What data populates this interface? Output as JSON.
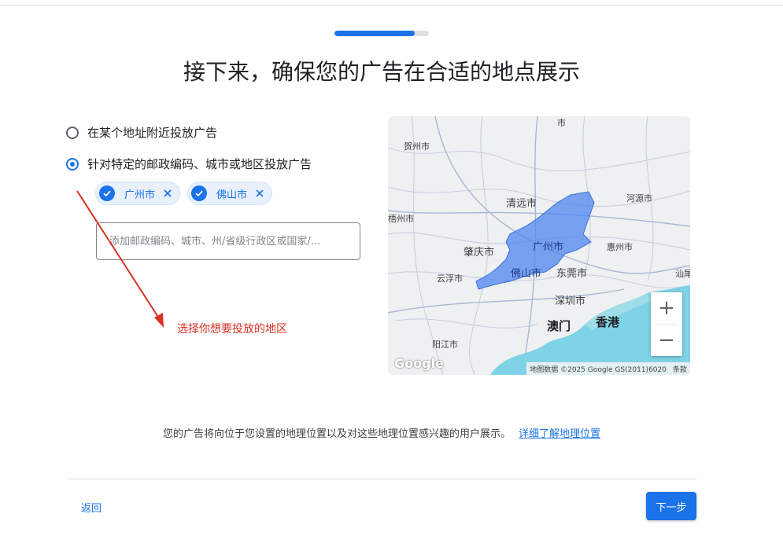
{
  "progress": {
    "percent": 85
  },
  "heading": {
    "title": "接下来，确保您的广告在合适的地点展示"
  },
  "targeting": {
    "options": [
      {
        "label": "在某个地址附近投放广告",
        "selected": false
      },
      {
        "label": "针对特定的邮政编码、城市或地区投放广告",
        "selected": true
      }
    ],
    "chips": [
      {
        "label": "广州市"
      },
      {
        "label": "佛山市"
      }
    ],
    "search_placeholder": "添加邮政编码、城市、州/省级行政区或国家/..."
  },
  "annotation": {
    "text": "选择你想要投放的地区",
    "color": "#d93025"
  },
  "map": {
    "cities": {
      "hezhou": "贺州市",
      "top": "市",
      "qingyuan": "清远市",
      "heyuan": "河源市",
      "wuzhou": "梧州市",
      "zhaoqing": "肇庆市",
      "guangzhou": "广州市",
      "huizhou": "惠州市",
      "yunfu": "云浮市",
      "foshan": "佛山市",
      "dongguan": "东莞市",
      "shantou": "汕尾",
      "shenzhen": "深圳市",
      "macau": "澳门",
      "hongkong": "香港",
      "yangjiang": "阳江市"
    },
    "zoom_in": "+",
    "zoom_out": "−",
    "logo": "Google",
    "attribution": "地图数据 ©2025 Google GS(2011)6020",
    "terms": "条款",
    "highlight_color": "#4f86f0"
  },
  "footer": {
    "note": "您的广告将向位于您设置的地理位置以及对这些地理位置感兴趣的用户展示。",
    "link": "详细了解地理位置",
    "back": "返回",
    "next": "下一步"
  }
}
